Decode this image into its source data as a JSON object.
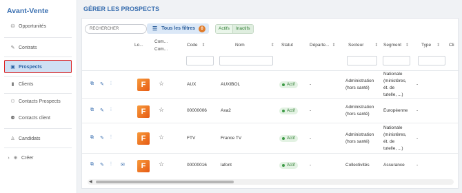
{
  "sidebar": {
    "title": "Avant-Vente",
    "items": [
      {
        "label": "Opportunités",
        "icon": "coins-icon"
      },
      {
        "label": "Contrats",
        "icon": "paperclip-icon"
      },
      {
        "label": "Prospects",
        "icon": "prospect-icon"
      },
      {
        "label": "Clients",
        "icon": "building-icon"
      },
      {
        "label": "Contacts Prospects",
        "icon": "people-icon"
      },
      {
        "label": "Contacts client",
        "icon": "people-icon"
      },
      {
        "label": "Candidats",
        "icon": "user-icon"
      },
      {
        "label": "Créer",
        "icon": "plus-circle-icon"
      }
    ]
  },
  "page": {
    "title": "GÉRER LES PROSPECTS"
  },
  "toolbar": {
    "search_placeholder": "RECHERCHER",
    "filters_label": "Tous les filtres",
    "filters_count": "0",
    "toggle_active": "Actifs",
    "toggle_inactive": "Inactifs"
  },
  "table": {
    "headers": {
      "logo": "Lo...",
      "com1": "Com...",
      "com2": "Com...",
      "code": "Code",
      "nom": "Nom",
      "statut": "Statut",
      "departement": "Départe...",
      "secteur": "Secteur",
      "segment": "Segment",
      "type": "Type",
      "cli": "Cli"
    },
    "rows": [
      {
        "code": "AUX",
        "nom": "AUXIBOL",
        "statut": "Actif",
        "departement": "-",
        "secteur": [
          "Administration",
          "(hors santé)"
        ],
        "segment": [
          "Nationale",
          "(ministères,",
          "ét. de",
          "tutelle, ...)"
        ],
        "type": "-"
      },
      {
        "code": "00000006",
        "nom": "Axa2",
        "statut": "Actif",
        "departement": "-",
        "secteur": [
          "Administration",
          "(hors santé)"
        ],
        "segment": [
          "Européenne"
        ],
        "type": "-"
      },
      {
        "code": "FTV",
        "nom": "France TV",
        "statut": "Actif",
        "departement": "-",
        "secteur": [
          "Administration",
          "(hors santé)"
        ],
        "segment": [
          "Nationale",
          "(ministères,",
          "ét. de",
          "tutelle, ...)"
        ],
        "type": "-"
      },
      {
        "code": "00000016",
        "nom": "lafont",
        "statut": "Actif",
        "departement": "-",
        "secteur": [
          "Collectivités"
        ],
        "segment": [
          "Assurance"
        ],
        "type": "-"
      }
    ]
  },
  "colors": {
    "accent": "#3a6fb0",
    "active_status": "#2e7d32",
    "badge": "#e07b2a",
    "logo": "#f07a2a"
  }
}
